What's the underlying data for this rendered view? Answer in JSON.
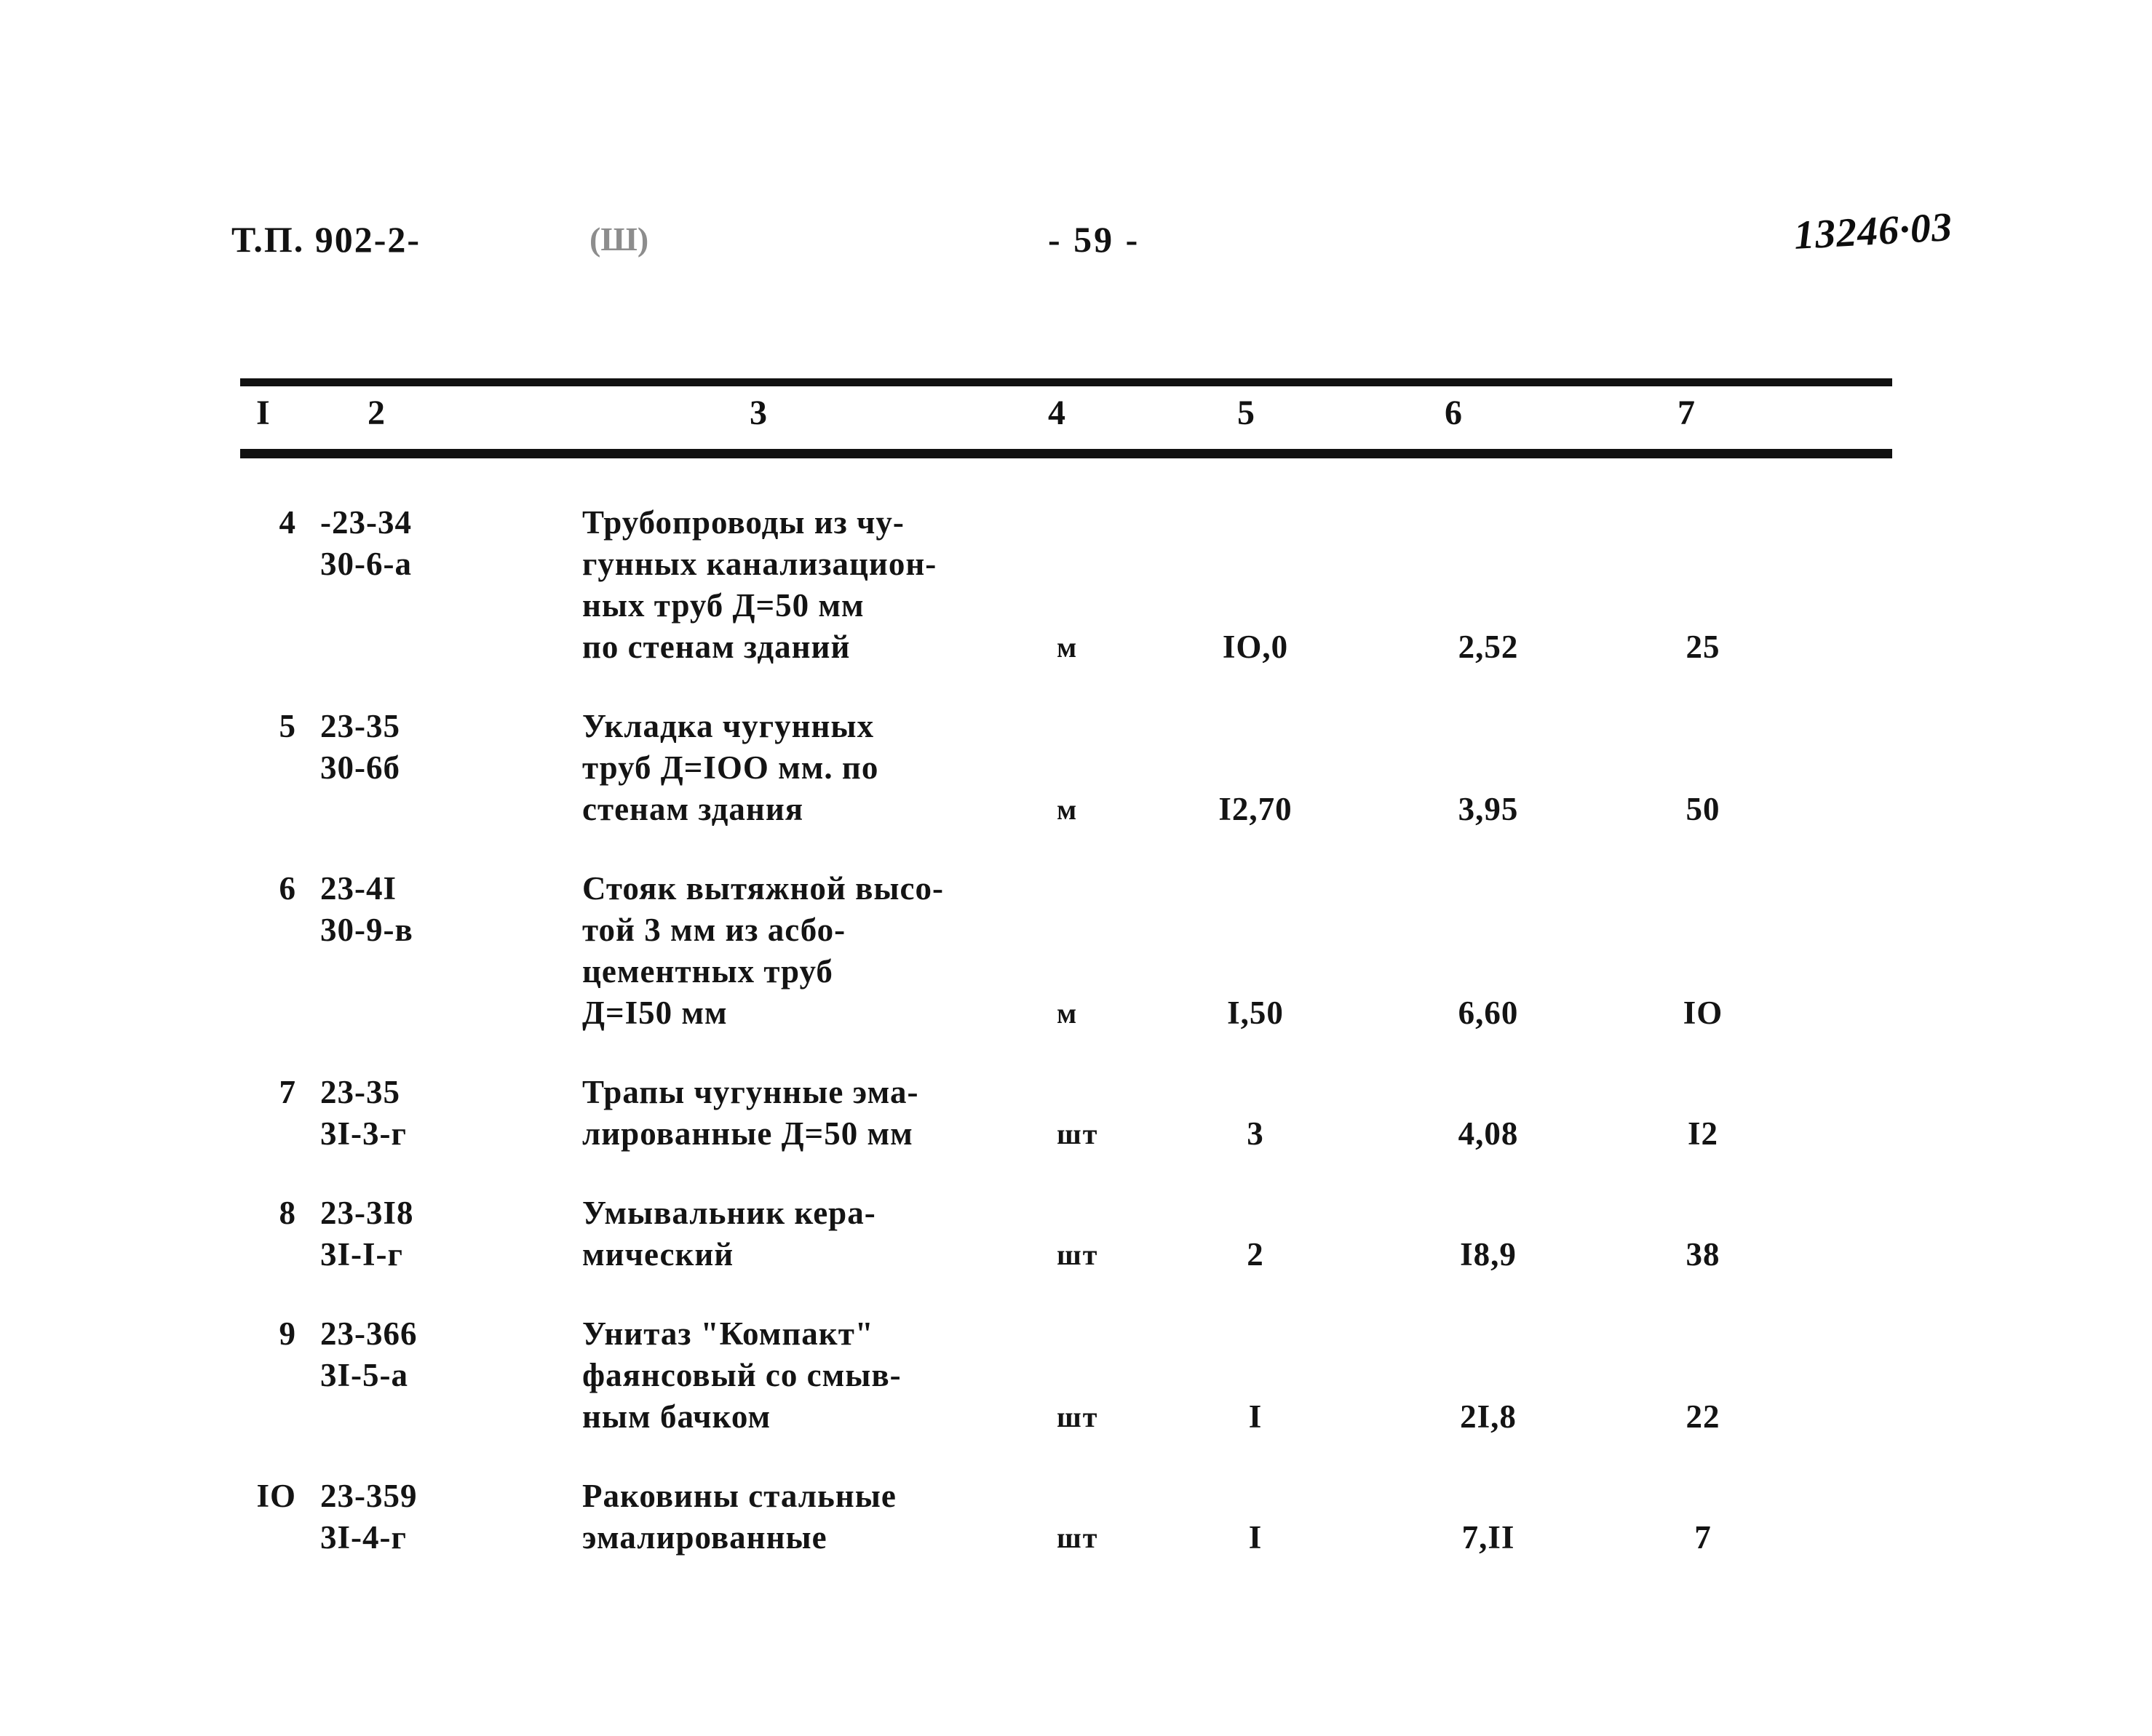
{
  "header": {
    "doc_code": "Т.П. 902-2-",
    "paren_mark": "(Ш)",
    "page_number": "- 59 -",
    "stamp": "13246·03"
  },
  "table": {
    "column_numbers": [
      "I",
      "2",
      "3",
      "4",
      "5",
      "6",
      "7"
    ],
    "rows": [
      {
        "no": "4",
        "code_line1": "-23-34",
        "code_line2": "30-6-а",
        "name_lines": [
          "Трубопроводы из чу-",
          "гунных канализацион-",
          "ных труб Д=50 мм",
          "по стенам зданий"
        ],
        "unit": "м",
        "qty": "IO,0",
        "price": "2,52",
        "total": "25"
      },
      {
        "no": "5",
        "code_line1": "23-35",
        "code_line2": "30-6б",
        "name_lines": [
          "Укладка чугунных",
          "труб Д=IOO мм. по",
          "стенам здания"
        ],
        "unit": "м",
        "qty": "I2,70",
        "price": "3,95",
        "total": "50"
      },
      {
        "no": "6",
        "code_line1": "23-4I",
        "code_line2": "30-9-в",
        "name_lines": [
          "Стояк вытяжной высо-",
          "той 3 мм из асбо-",
          "цементных труб",
          "Д=I50 мм"
        ],
        "unit": "м",
        "qty": "I,50",
        "price": "6,60",
        "total": "IO"
      },
      {
        "no": "7",
        "code_line1": "23-35",
        "code_line2": "3I-3-г",
        "name_lines": [
          "Трапы чугунные эма-",
          "лированные Д=50 мм"
        ],
        "unit": "шт",
        "qty": "3",
        "price": "4,08",
        "total": "I2"
      },
      {
        "no": "8",
        "code_line1": "23-3I8",
        "code_line2": "3I-I-г",
        "name_lines": [
          "Умывальник кера-",
          "мический"
        ],
        "unit": "шт",
        "qty": "2",
        "price": "I8,9",
        "total": "38"
      },
      {
        "no": "9",
        "code_line1": "23-366",
        "code_line2": "3I-5-а",
        "name_lines": [
          "Унитаз \"Компакт\"",
          "фаянсовый со смыв-",
          "ным бачком"
        ],
        "unit": "шт",
        "qty": "I",
        "price": "2I,8",
        "total": "22"
      },
      {
        "no": "IO",
        "code_line1": "23-359",
        "code_line2": "3I-4-г",
        "name_lines": [
          "Раковины стальные",
          "эмалированные"
        ],
        "unit": "шт",
        "qty": "I",
        "price": "7,II",
        "total": "7"
      }
    ]
  }
}
